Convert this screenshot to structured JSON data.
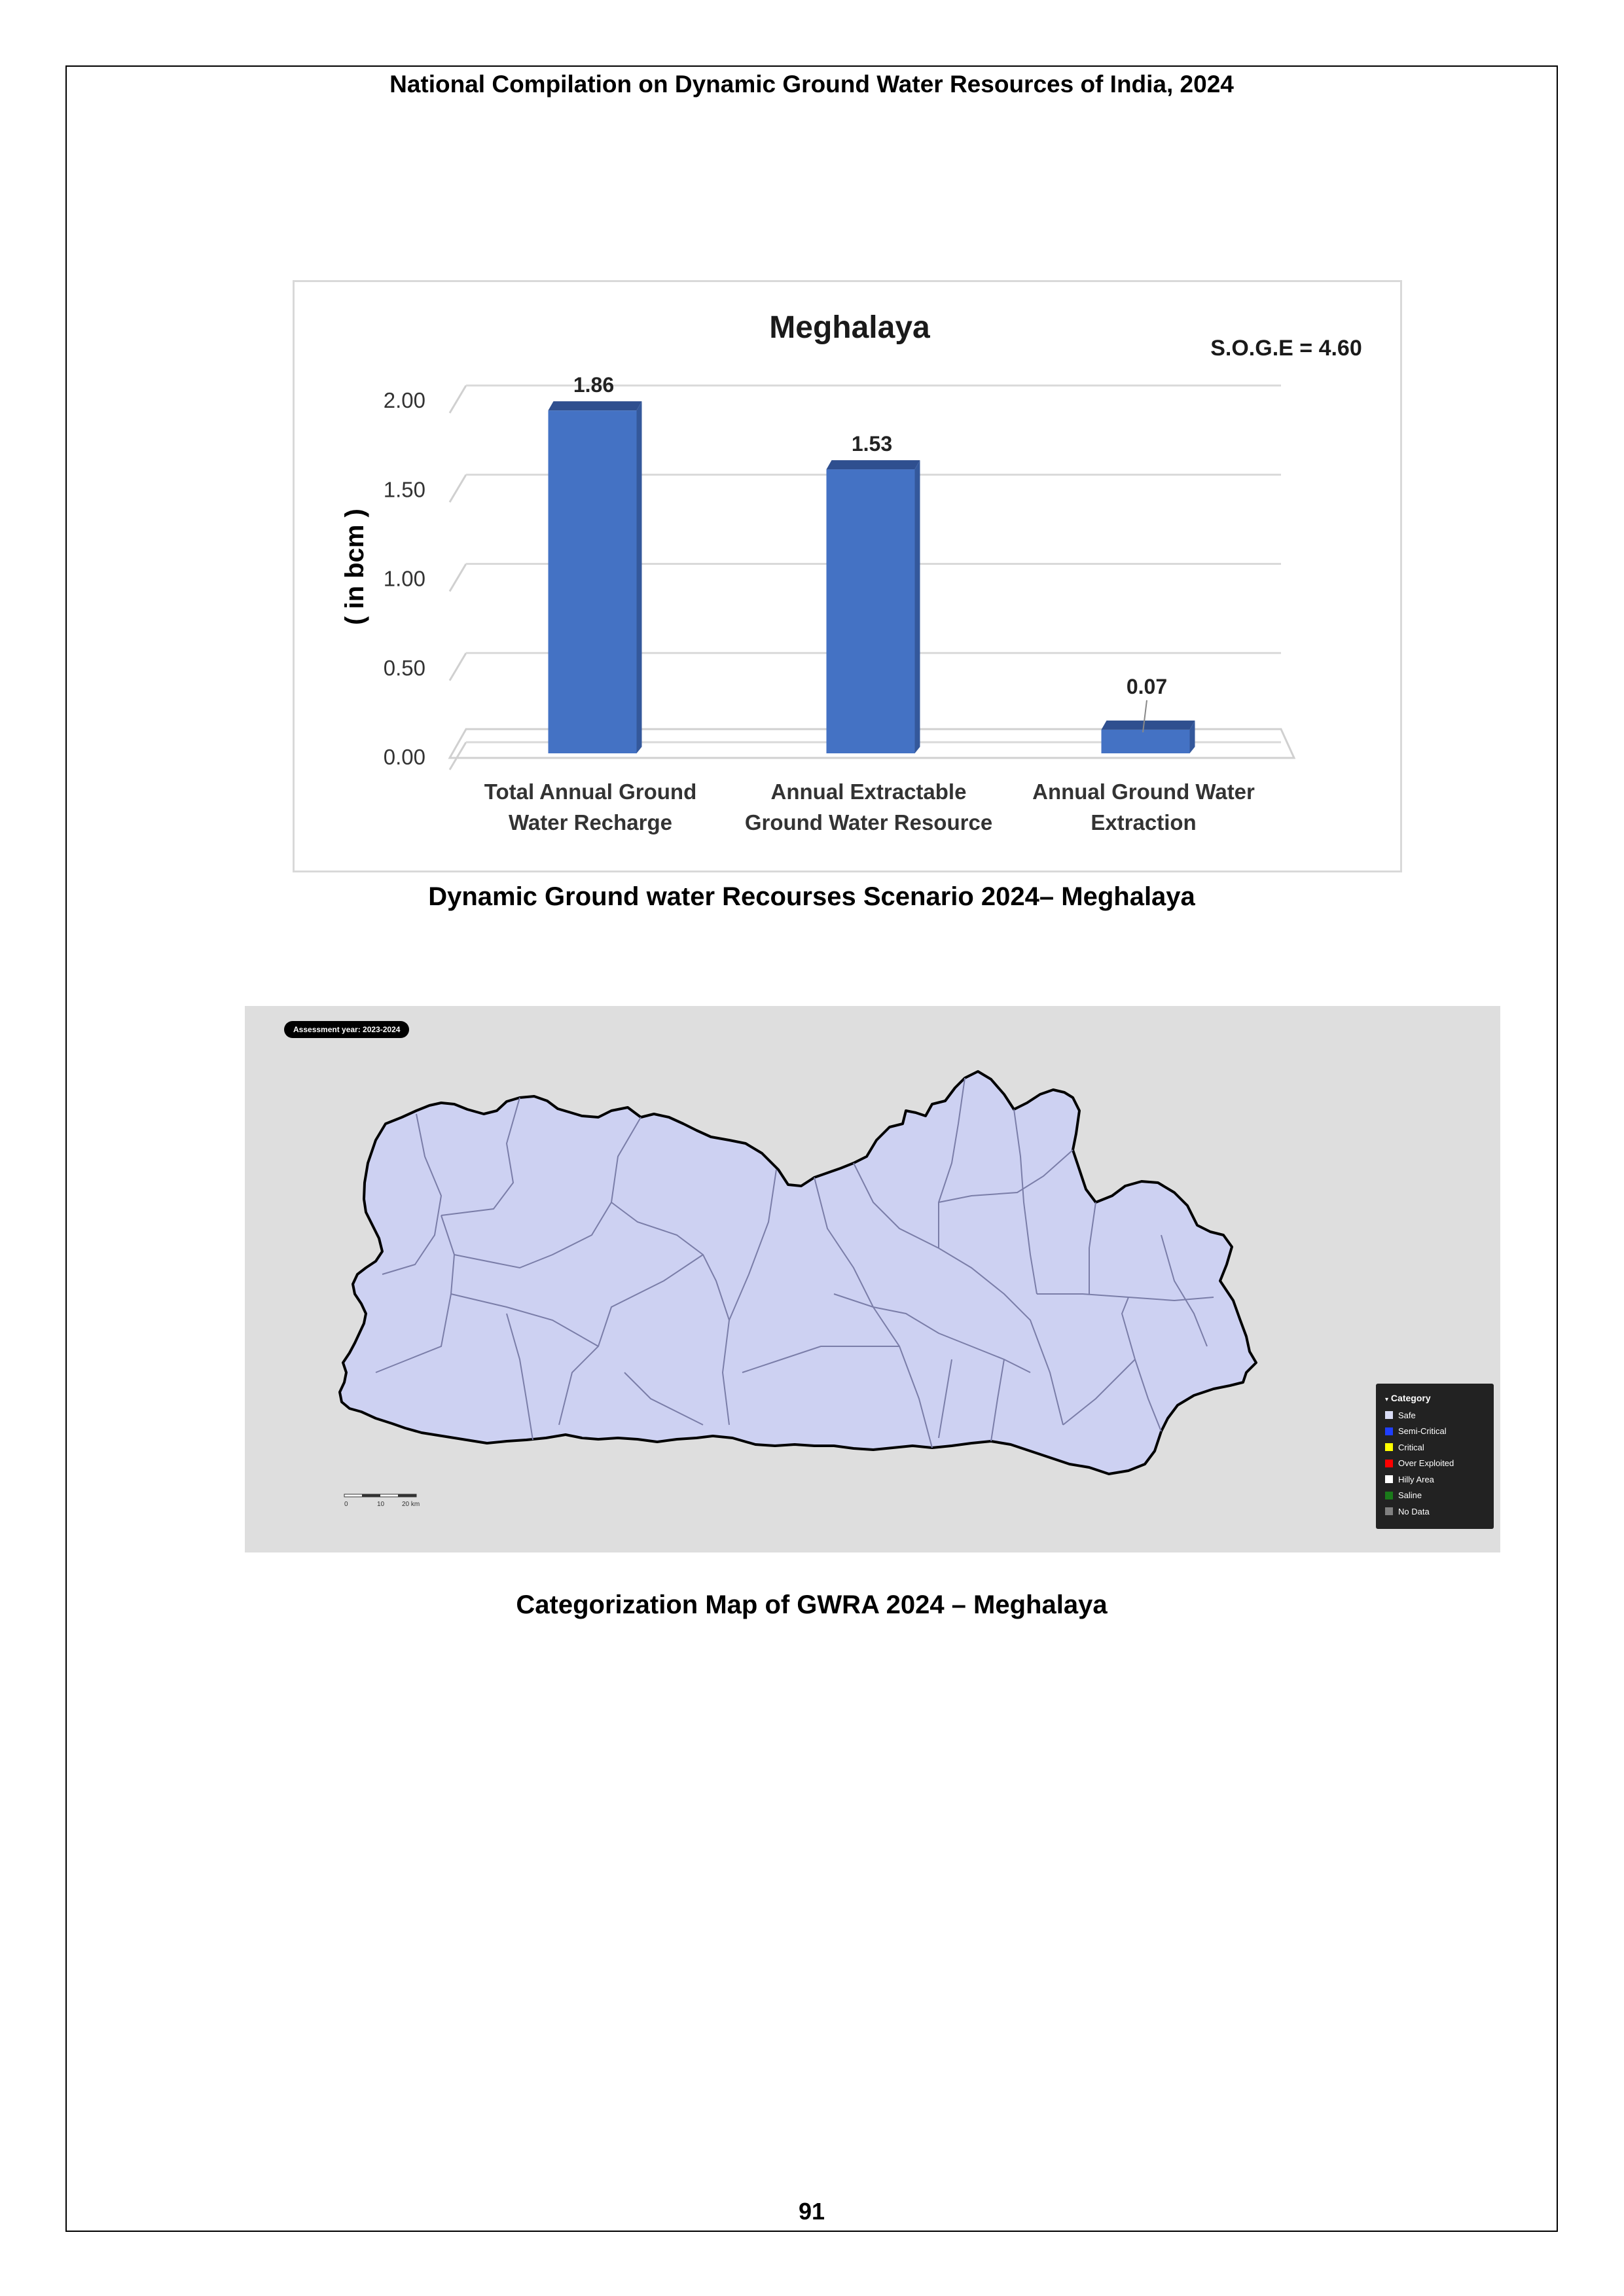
{
  "header": {
    "title": "National Compilation on Dynamic Ground Water Resources of India, 2024"
  },
  "chart_data": {
    "type": "bar",
    "title": "Meghalaya",
    "annotation": "S.O.G.E = 4.60",
    "ylabel": "( in bcm )",
    "xlabel": "",
    "ylim": [
      0,
      2.0
    ],
    "yticks": [
      "0.00",
      "0.50",
      "1.00",
      "1.50",
      "2.00"
    ],
    "categories": [
      [
        "Total Annual  Ground",
        "Water Recharge"
      ],
      [
        "Annual Extractable",
        "Ground Water Resource"
      ],
      [
        "Annual Ground Water",
        "Extraction"
      ]
    ],
    "values": [
      1.86,
      1.53,
      0.07
    ],
    "data_labels": [
      "1.86",
      "1.53",
      "0.07"
    ],
    "bar_color": "#4472c4",
    "bar_top_color": "#2f4f8f",
    "grid": true,
    "style": "3d"
  },
  "chart_caption": "Dynamic Ground water Recourses Scenario 2024– Meghalaya",
  "map": {
    "assessment_label": "Assessment year: 2023-2024",
    "fill_color": "#cdd1f2",
    "legend": {
      "title": "Category",
      "items": [
        {
          "label": "Safe",
          "color": "#d9dcf5"
        },
        {
          "label": "Semi-Critical",
          "color": "#1f3fff"
        },
        {
          "label": "Critical",
          "color": "#ffff00"
        },
        {
          "label": "Over Exploited",
          "color": "#ff0000"
        },
        {
          "label": "Hilly Area",
          "color": "#ffffff"
        },
        {
          "label": "Saline",
          "color": "#1a7a1a"
        },
        {
          "label": "No Data",
          "color": "#808080"
        }
      ]
    },
    "scale_labels": [
      "0",
      "10",
      "20 km"
    ]
  },
  "map_caption": "Categorization Map of GWRA 2024 – Meghalaya",
  "page_number": "91"
}
